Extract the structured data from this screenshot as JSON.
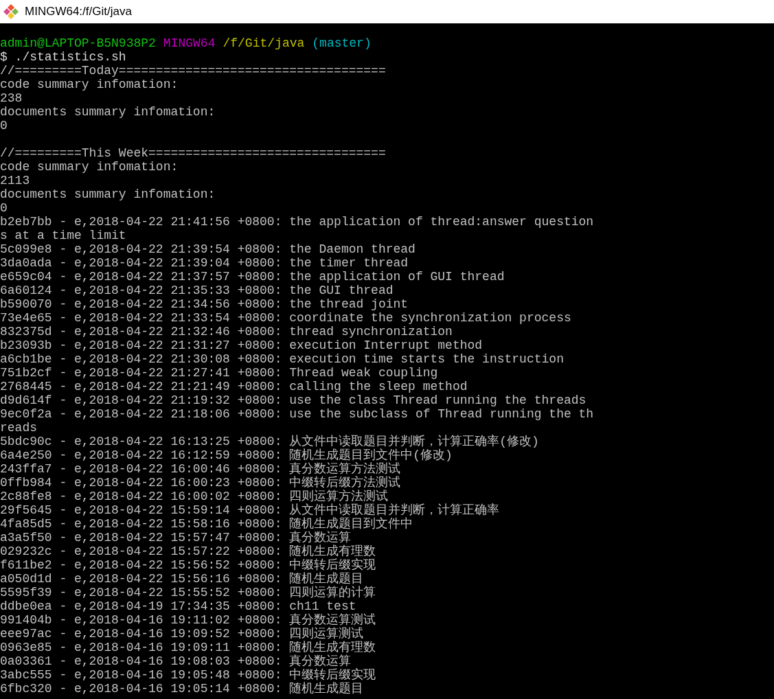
{
  "window": {
    "title": "MINGW64:/f/Git/java"
  },
  "prompt": {
    "user_host": "admin@LAPTOP-B5N938P2",
    "shell": "MINGW64",
    "path": "/f/Git/java",
    "branch": "(master)"
  },
  "lines": [
    {
      "kind": "command",
      "text": "$ ./statistics.sh"
    },
    {
      "kind": "output",
      "text": "//=========Today===================================="
    },
    {
      "kind": "output",
      "text": "code summary infomation:"
    },
    {
      "kind": "output",
      "text": "238"
    },
    {
      "kind": "output",
      "text": "documents summary infomation:"
    },
    {
      "kind": "output",
      "text": "0"
    },
    {
      "kind": "blank"
    },
    {
      "kind": "output",
      "text": "//=========This Week================================"
    },
    {
      "kind": "output",
      "text": "code summary infomation:"
    },
    {
      "kind": "output",
      "text": "2113"
    },
    {
      "kind": "output",
      "text": "documents summary infomation:"
    },
    {
      "kind": "output",
      "text": "0"
    },
    {
      "kind": "output",
      "text": "b2eb7bb - e,2018-04-22 21:41:56 +0800: the application of thread:answer question"
    },
    {
      "kind": "output",
      "text": "s at a time limit"
    },
    {
      "kind": "output",
      "text": "5c099e8 - e,2018-04-22 21:39:54 +0800: the Daemon thread"
    },
    {
      "kind": "output",
      "text": "3da0ada - e,2018-04-22 21:39:04 +0800: the timer thread"
    },
    {
      "kind": "output",
      "text": "e659c04 - e,2018-04-22 21:37:57 +0800: the application of GUI thread"
    },
    {
      "kind": "output",
      "text": "6a60124 - e,2018-04-22 21:35:33 +0800: the GUI thread"
    },
    {
      "kind": "output",
      "text": "b590070 - e,2018-04-22 21:34:56 +0800: the thread joint"
    },
    {
      "kind": "output",
      "text": "73e4e65 - e,2018-04-22 21:33:54 +0800: coordinate the synchronization process"
    },
    {
      "kind": "output",
      "text": "832375d - e,2018-04-22 21:32:46 +0800: thread synchronization"
    },
    {
      "kind": "output",
      "text": "b23093b - e,2018-04-22 21:31:27 +0800: execution Interrupt method"
    },
    {
      "kind": "output",
      "text": "a6cb1be - e,2018-04-22 21:30:08 +0800: execution time starts the instruction"
    },
    {
      "kind": "output",
      "text": "751b2cf - e,2018-04-22 21:27:41 +0800: Thread weak coupling"
    },
    {
      "kind": "output",
      "text": "2768445 - e,2018-04-22 21:21:49 +0800: calling the sleep method"
    },
    {
      "kind": "output",
      "text": "d9d614f - e,2018-04-22 21:19:32 +0800: use the class Thread running the threads"
    },
    {
      "kind": "output",
      "text": "9ec0f2a - e,2018-04-22 21:18:06 +0800: use the subclass of Thread running the th"
    },
    {
      "kind": "output",
      "text": "reads"
    },
    {
      "kind": "output",
      "text": "5bdc90c - e,2018-04-22 16:13:25 +0800: 从文件中读取题目并判断，计算正确率(修改)"
    },
    {
      "kind": "output",
      "text": "6a4e250 - e,2018-04-22 16:12:59 +0800: 随机生成题目到文件中(修改)"
    },
    {
      "kind": "output",
      "text": "243ffa7 - e,2018-04-22 16:00:46 +0800: 真分数运算方法测试"
    },
    {
      "kind": "output",
      "text": "0ffb984 - e,2018-04-22 16:00:23 +0800: 中缀转后缀方法测试"
    },
    {
      "kind": "output",
      "text": "2c88fe8 - e,2018-04-22 16:00:02 +0800: 四则运算方法测试"
    },
    {
      "kind": "output",
      "text": "29f5645 - e,2018-04-22 15:59:14 +0800: 从文件中读取题目并判断，计算正确率"
    },
    {
      "kind": "output",
      "text": "4fa85d5 - e,2018-04-22 15:58:16 +0800: 随机生成题目到文件中"
    },
    {
      "kind": "output",
      "text": "a3a5f50 - e,2018-04-22 15:57:47 +0800: 真分数运算"
    },
    {
      "kind": "output",
      "text": "029232c - e,2018-04-22 15:57:22 +0800: 随机生成有理数"
    },
    {
      "kind": "output",
      "text": "f611be2 - e,2018-04-22 15:56:52 +0800: 中缀转后缀实现"
    },
    {
      "kind": "output",
      "text": "a050d1d - e,2018-04-22 15:56:16 +0800: 随机生成题目"
    },
    {
      "kind": "output",
      "text": "5595f39 - e,2018-04-22 15:55:52 +0800: 四则运算的计算"
    },
    {
      "kind": "output",
      "text": "ddbe0ea - e,2018-04-19 17:34:35 +0800: ch11 test"
    },
    {
      "kind": "output",
      "text": "991404b - e,2018-04-16 19:11:02 +0800: 真分数运算测试"
    },
    {
      "kind": "output",
      "text": "eee97ac - e,2018-04-16 19:09:52 +0800: 四则运算测试"
    },
    {
      "kind": "output",
      "text": "0963e85 - e,2018-04-16 19:09:11 +0800: 随机生成有理数"
    },
    {
      "kind": "output",
      "text": "0a03361 - e,2018-04-16 19:08:03 +0800: 真分数运算"
    },
    {
      "kind": "output",
      "text": "3abc555 - e,2018-04-16 19:05:48 +0800: 中缀转后缀实现"
    },
    {
      "kind": "output",
      "text": "6fbc320 - e,2018-04-16 19:05:14 +0800: 随机生成题目"
    }
  ]
}
